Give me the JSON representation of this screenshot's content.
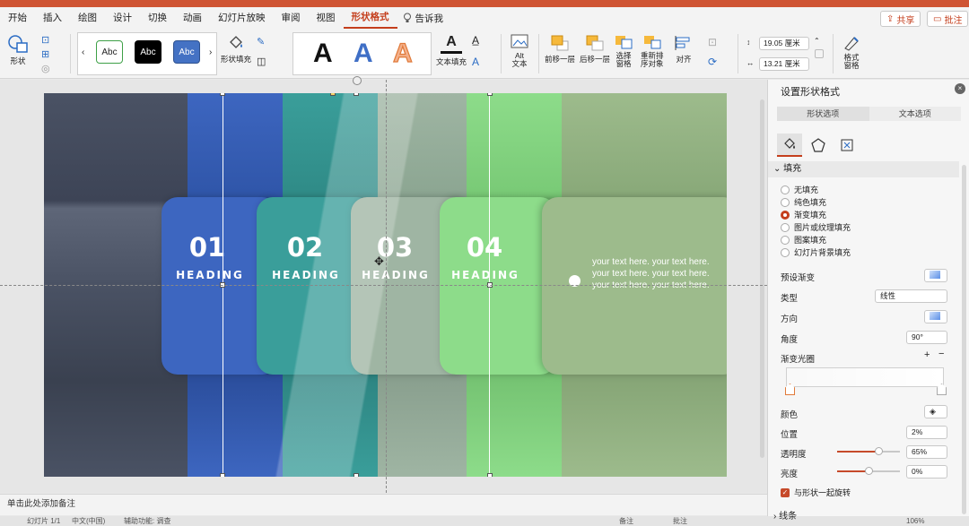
{
  "menu": {
    "tabs": [
      {
        "label": "开始"
      },
      {
        "label": "插入"
      },
      {
        "label": "绘图"
      },
      {
        "label": "设计"
      },
      {
        "label": "切换"
      },
      {
        "label": "动画"
      },
      {
        "label": "幻灯片放映"
      },
      {
        "label": "审阅"
      },
      {
        "label": "视图"
      },
      {
        "label": "形状格式",
        "active": true
      }
    ],
    "tell_me": "告诉我",
    "share": "共享",
    "comments": "批注"
  },
  "ribbon": {
    "shape_label": "形状",
    "style_samples": [
      "Abc",
      "Abc",
      "Abc"
    ],
    "shape_fill": "形状填充",
    "wordart_letter": "A",
    "text_fill": "文本填充",
    "alt_text": "Alt\n文本",
    "bring_forward": "前移一层",
    "send_backward": "后移一层",
    "selection_pane": "选择\n窗格",
    "reorder": "重新排\n序对象",
    "align": "对齐",
    "height_value": "19.05 厘米",
    "width_value": "13.21 厘米",
    "format_pane": "格式\n窗格"
  },
  "slide": {
    "items": [
      {
        "number": "01",
        "heading": "HEADING"
      },
      {
        "number": "02",
        "heading": "HEADING"
      },
      {
        "number": "03",
        "heading": "HEADING"
      },
      {
        "number": "04",
        "heading": "HEADING"
      }
    ],
    "body_text": "your text here. your text here. your text here. your text here. your text here. your text here.",
    "colors": {
      "dark": "#4a5264",
      "blue": "#3d66c0",
      "teal": "#3a9e9a",
      "sage": "#9fb5a3",
      "green": "#8ddc8a",
      "olive": "#9dbb8c"
    }
  },
  "notes_placeholder": "单击此处添加备注",
  "status": {
    "slide_info": "幻灯片 1/1",
    "language": "中文(中国)",
    "accessibility": "辅助功能: 调查",
    "notes_btn": "备注",
    "comments_btn": "批注",
    "zoom": "106%"
  },
  "pane": {
    "title": "设置形状格式",
    "tabs": [
      "形状选项",
      "文本选项"
    ],
    "fill_section": "填充",
    "fill_options": [
      {
        "label": "无填充",
        "selected": false
      },
      {
        "label": "纯色填充",
        "selected": false
      },
      {
        "label": "渐变填充",
        "selected": true
      },
      {
        "label": "图片或纹理填充",
        "selected": false
      },
      {
        "label": "图案填充",
        "selected": false
      },
      {
        "label": "幻灯片背景填充",
        "selected": false
      }
    ],
    "preset_label": "预设渐变",
    "type_label": "类型",
    "type_value": "线性",
    "direction_label": "方向",
    "angle_label": "角度",
    "angle_value": "90°",
    "stops_label": "渐变光圈",
    "color_label": "颜色",
    "position_label": "位置",
    "position_value": "2%",
    "transparency_label": "透明度",
    "transparency_value": "65%",
    "transparency_level": 0.65,
    "brightness_label": "亮度",
    "brightness_value": "0%",
    "brightness_level": 0.5,
    "rotate_with_shape": "与形状一起旋转",
    "line_section": "线条"
  }
}
